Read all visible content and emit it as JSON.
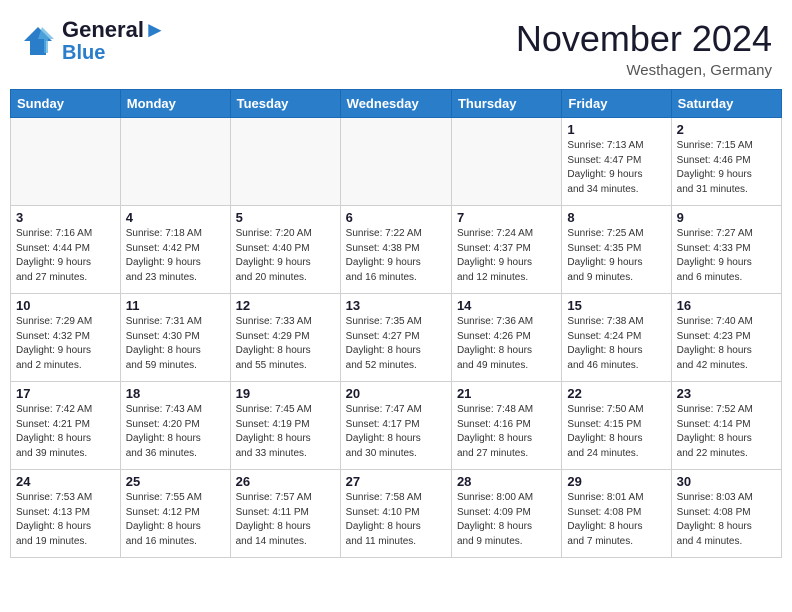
{
  "header": {
    "logo_line1": "General",
    "logo_line2": "Blue",
    "month": "November 2024",
    "location": "Westhagen, Germany"
  },
  "weekdays": [
    "Sunday",
    "Monday",
    "Tuesday",
    "Wednesday",
    "Thursday",
    "Friday",
    "Saturday"
  ],
  "weeks": [
    [
      {
        "day": "",
        "info": ""
      },
      {
        "day": "",
        "info": ""
      },
      {
        "day": "",
        "info": ""
      },
      {
        "day": "",
        "info": ""
      },
      {
        "day": "",
        "info": ""
      },
      {
        "day": "1",
        "info": "Sunrise: 7:13 AM\nSunset: 4:47 PM\nDaylight: 9 hours\nand 34 minutes."
      },
      {
        "day": "2",
        "info": "Sunrise: 7:15 AM\nSunset: 4:46 PM\nDaylight: 9 hours\nand 31 minutes."
      }
    ],
    [
      {
        "day": "3",
        "info": "Sunrise: 7:16 AM\nSunset: 4:44 PM\nDaylight: 9 hours\nand 27 minutes."
      },
      {
        "day": "4",
        "info": "Sunrise: 7:18 AM\nSunset: 4:42 PM\nDaylight: 9 hours\nand 23 minutes."
      },
      {
        "day": "5",
        "info": "Sunrise: 7:20 AM\nSunset: 4:40 PM\nDaylight: 9 hours\nand 20 minutes."
      },
      {
        "day": "6",
        "info": "Sunrise: 7:22 AM\nSunset: 4:38 PM\nDaylight: 9 hours\nand 16 minutes."
      },
      {
        "day": "7",
        "info": "Sunrise: 7:24 AM\nSunset: 4:37 PM\nDaylight: 9 hours\nand 12 minutes."
      },
      {
        "day": "8",
        "info": "Sunrise: 7:25 AM\nSunset: 4:35 PM\nDaylight: 9 hours\nand 9 minutes."
      },
      {
        "day": "9",
        "info": "Sunrise: 7:27 AM\nSunset: 4:33 PM\nDaylight: 9 hours\nand 6 minutes."
      }
    ],
    [
      {
        "day": "10",
        "info": "Sunrise: 7:29 AM\nSunset: 4:32 PM\nDaylight: 9 hours\nand 2 minutes."
      },
      {
        "day": "11",
        "info": "Sunrise: 7:31 AM\nSunset: 4:30 PM\nDaylight: 8 hours\nand 59 minutes."
      },
      {
        "day": "12",
        "info": "Sunrise: 7:33 AM\nSunset: 4:29 PM\nDaylight: 8 hours\nand 55 minutes."
      },
      {
        "day": "13",
        "info": "Sunrise: 7:35 AM\nSunset: 4:27 PM\nDaylight: 8 hours\nand 52 minutes."
      },
      {
        "day": "14",
        "info": "Sunrise: 7:36 AM\nSunset: 4:26 PM\nDaylight: 8 hours\nand 49 minutes."
      },
      {
        "day": "15",
        "info": "Sunrise: 7:38 AM\nSunset: 4:24 PM\nDaylight: 8 hours\nand 46 minutes."
      },
      {
        "day": "16",
        "info": "Sunrise: 7:40 AM\nSunset: 4:23 PM\nDaylight: 8 hours\nand 42 minutes."
      }
    ],
    [
      {
        "day": "17",
        "info": "Sunrise: 7:42 AM\nSunset: 4:21 PM\nDaylight: 8 hours\nand 39 minutes."
      },
      {
        "day": "18",
        "info": "Sunrise: 7:43 AM\nSunset: 4:20 PM\nDaylight: 8 hours\nand 36 minutes."
      },
      {
        "day": "19",
        "info": "Sunrise: 7:45 AM\nSunset: 4:19 PM\nDaylight: 8 hours\nand 33 minutes."
      },
      {
        "day": "20",
        "info": "Sunrise: 7:47 AM\nSunset: 4:17 PM\nDaylight: 8 hours\nand 30 minutes."
      },
      {
        "day": "21",
        "info": "Sunrise: 7:48 AM\nSunset: 4:16 PM\nDaylight: 8 hours\nand 27 minutes."
      },
      {
        "day": "22",
        "info": "Sunrise: 7:50 AM\nSunset: 4:15 PM\nDaylight: 8 hours\nand 24 minutes."
      },
      {
        "day": "23",
        "info": "Sunrise: 7:52 AM\nSunset: 4:14 PM\nDaylight: 8 hours\nand 22 minutes."
      }
    ],
    [
      {
        "day": "24",
        "info": "Sunrise: 7:53 AM\nSunset: 4:13 PM\nDaylight: 8 hours\nand 19 minutes."
      },
      {
        "day": "25",
        "info": "Sunrise: 7:55 AM\nSunset: 4:12 PM\nDaylight: 8 hours\nand 16 minutes."
      },
      {
        "day": "26",
        "info": "Sunrise: 7:57 AM\nSunset: 4:11 PM\nDaylight: 8 hours\nand 14 minutes."
      },
      {
        "day": "27",
        "info": "Sunrise: 7:58 AM\nSunset: 4:10 PM\nDaylight: 8 hours\nand 11 minutes."
      },
      {
        "day": "28",
        "info": "Sunrise: 8:00 AM\nSunset: 4:09 PM\nDaylight: 8 hours\nand 9 minutes."
      },
      {
        "day": "29",
        "info": "Sunrise: 8:01 AM\nSunset: 4:08 PM\nDaylight: 8 hours\nand 7 minutes."
      },
      {
        "day": "30",
        "info": "Sunrise: 8:03 AM\nSunset: 4:08 PM\nDaylight: 8 hours\nand 4 minutes."
      }
    ]
  ]
}
